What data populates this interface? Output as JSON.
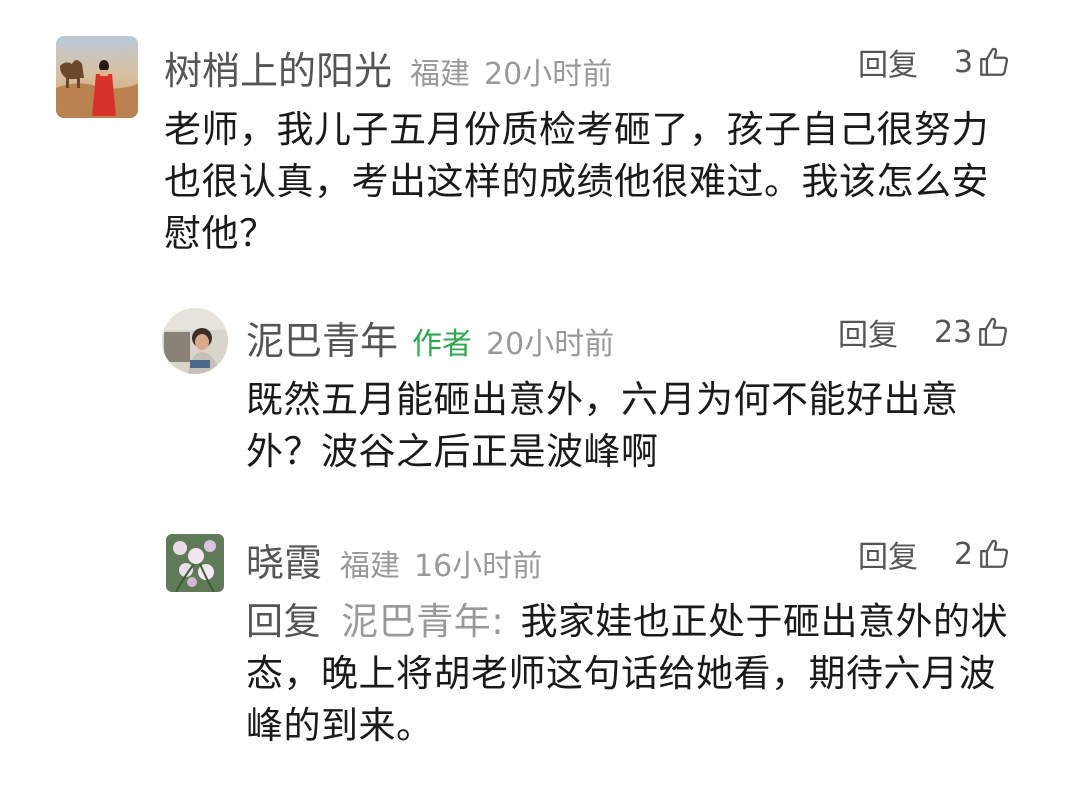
{
  "comments": [
    {
      "username": "树梢上的阳光",
      "location": "福建",
      "time": "20小时前",
      "reply_label": "回复",
      "likes": "3",
      "avatar": "avatar-photo-woman-red-dress",
      "text": "老师，我儿子五月份质检考砸了，孩子自己很努力也很认真，考出这样的成绩他很难过。我该怎么安慰他？"
    },
    {
      "username": "泥巴青年",
      "author_tag": "作者",
      "time": "20小时前",
      "reply_label": "回复",
      "likes": "23",
      "avatar": "avatar-photo-man",
      "text": "既然五月能砸出意外，六月为何不能好出意外？波谷之后正是波峰啊"
    },
    {
      "username": "晓霞",
      "location": "福建",
      "time": "16小时前",
      "reply_label": "回复",
      "likes": "2",
      "avatar": "avatar-photo-flowers",
      "reply_prefix": "回复",
      "reply_target": "泥巴青年:",
      "text": "我家娃也正处于砸出意外的状态，晚上将胡老师这句话给她看，期待六月波峰的到来。"
    }
  ],
  "colors": {
    "author_tag": "#2fa84f",
    "muted": "#999999",
    "username": "#555555",
    "body": "#1a1a1a"
  },
  "icons": [
    "thumbs-up-icon"
  ]
}
